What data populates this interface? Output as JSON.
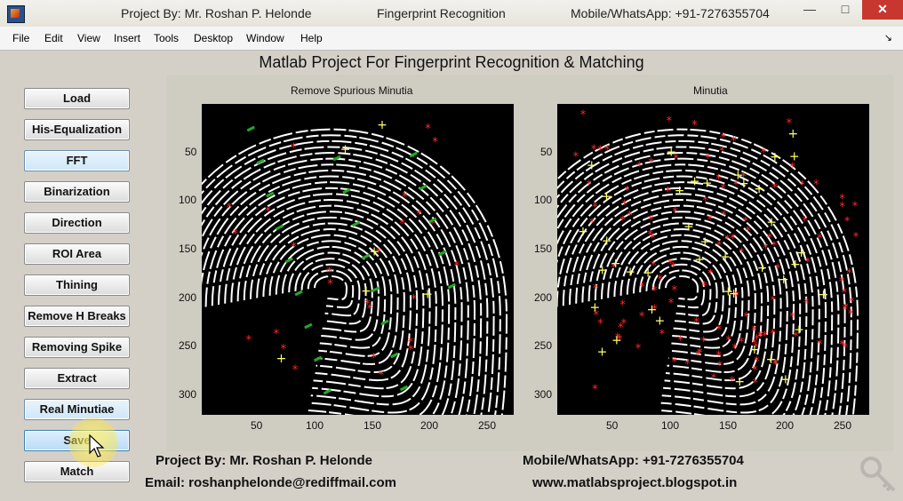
{
  "titlebar": {
    "left": "Project By: Mr. Roshan P. Helonde",
    "center": "Fingerprint Recognition",
    "right": "Mobile/WhatsApp: +91-7276355704",
    "minimize": "—",
    "maximize": "□",
    "close": "✕"
  },
  "menubar": [
    "File",
    "Edit",
    "View",
    "Insert",
    "Tools",
    "Desktop",
    "Window",
    "Help"
  ],
  "dock_icon": "↘",
  "header": "Matlab Project For Fingerprint Recognition & Matching",
  "buttons": [
    "Load",
    "His-Equalization",
    "FFT",
    "Binarization",
    "Direction",
    "ROI Area",
    "Thining",
    "Remove H Breaks",
    "Removing Spike",
    "Extract",
    "Real Minutiae",
    "Save",
    "Match"
  ],
  "plots": [
    {
      "title": "Remove Spurious Minutia",
      "yticks": [
        "50",
        "100",
        "150",
        "200",
        "250",
        "300"
      ],
      "xticks": [
        "50",
        "100",
        "150",
        "200",
        "250"
      ]
    },
    {
      "title": "Minutia",
      "yticks": [
        "50",
        "100",
        "150",
        "200",
        "250",
        "300"
      ],
      "xticks": [
        "50",
        "100",
        "150",
        "200",
        "250"
      ]
    }
  ],
  "footer": {
    "project": "Project By:  Mr. Roshan P. Helonde",
    "mobile": "Mobile/WhatsApp: +91-7276355704",
    "email": "Email: roshanphelonde@rediffmail.com",
    "website": "www.matlabsproject.blogspot.in"
  },
  "icons": [
    "matlab-figure-icon",
    "pointer-cursor-icon",
    "keys-watermark-icon"
  ],
  "colors": {
    "background": "#d4d0c8",
    "plot_bg": "#000000",
    "ridge": "#ffffff",
    "termination": "#ff2a2a",
    "bifurcation": "#ffff66",
    "spurious": "#22aa22"
  }
}
